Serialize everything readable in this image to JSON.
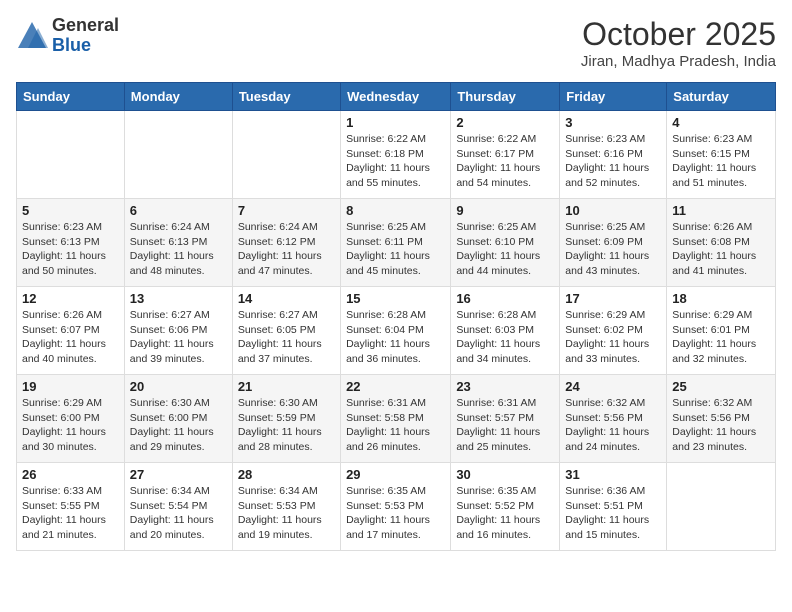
{
  "logo": {
    "general": "General",
    "blue": "Blue"
  },
  "header": {
    "month": "October 2025",
    "location": "Jiran, Madhya Pradesh, India"
  },
  "weekdays": [
    "Sunday",
    "Monday",
    "Tuesday",
    "Wednesday",
    "Thursday",
    "Friday",
    "Saturday"
  ],
  "weeks": [
    [
      {
        "day": "",
        "info": ""
      },
      {
        "day": "",
        "info": ""
      },
      {
        "day": "",
        "info": ""
      },
      {
        "day": "1",
        "info": "Sunrise: 6:22 AM\nSunset: 6:18 PM\nDaylight: 11 hours\nand 55 minutes."
      },
      {
        "day": "2",
        "info": "Sunrise: 6:22 AM\nSunset: 6:17 PM\nDaylight: 11 hours\nand 54 minutes."
      },
      {
        "day": "3",
        "info": "Sunrise: 6:23 AM\nSunset: 6:16 PM\nDaylight: 11 hours\nand 52 minutes."
      },
      {
        "day": "4",
        "info": "Sunrise: 6:23 AM\nSunset: 6:15 PM\nDaylight: 11 hours\nand 51 minutes."
      }
    ],
    [
      {
        "day": "5",
        "info": "Sunrise: 6:23 AM\nSunset: 6:13 PM\nDaylight: 11 hours\nand 50 minutes."
      },
      {
        "day": "6",
        "info": "Sunrise: 6:24 AM\nSunset: 6:13 PM\nDaylight: 11 hours\nand 48 minutes."
      },
      {
        "day": "7",
        "info": "Sunrise: 6:24 AM\nSunset: 6:12 PM\nDaylight: 11 hours\nand 47 minutes."
      },
      {
        "day": "8",
        "info": "Sunrise: 6:25 AM\nSunset: 6:11 PM\nDaylight: 11 hours\nand 45 minutes."
      },
      {
        "day": "9",
        "info": "Sunrise: 6:25 AM\nSunset: 6:10 PM\nDaylight: 11 hours\nand 44 minutes."
      },
      {
        "day": "10",
        "info": "Sunrise: 6:25 AM\nSunset: 6:09 PM\nDaylight: 11 hours\nand 43 minutes."
      },
      {
        "day": "11",
        "info": "Sunrise: 6:26 AM\nSunset: 6:08 PM\nDaylight: 11 hours\nand 41 minutes."
      }
    ],
    [
      {
        "day": "12",
        "info": "Sunrise: 6:26 AM\nSunset: 6:07 PM\nDaylight: 11 hours\nand 40 minutes."
      },
      {
        "day": "13",
        "info": "Sunrise: 6:27 AM\nSunset: 6:06 PM\nDaylight: 11 hours\nand 39 minutes."
      },
      {
        "day": "14",
        "info": "Sunrise: 6:27 AM\nSunset: 6:05 PM\nDaylight: 11 hours\nand 37 minutes."
      },
      {
        "day": "15",
        "info": "Sunrise: 6:28 AM\nSunset: 6:04 PM\nDaylight: 11 hours\nand 36 minutes."
      },
      {
        "day": "16",
        "info": "Sunrise: 6:28 AM\nSunset: 6:03 PM\nDaylight: 11 hours\nand 34 minutes."
      },
      {
        "day": "17",
        "info": "Sunrise: 6:29 AM\nSunset: 6:02 PM\nDaylight: 11 hours\nand 33 minutes."
      },
      {
        "day": "18",
        "info": "Sunrise: 6:29 AM\nSunset: 6:01 PM\nDaylight: 11 hours\nand 32 minutes."
      }
    ],
    [
      {
        "day": "19",
        "info": "Sunrise: 6:29 AM\nSunset: 6:00 PM\nDaylight: 11 hours\nand 30 minutes."
      },
      {
        "day": "20",
        "info": "Sunrise: 6:30 AM\nSunset: 6:00 PM\nDaylight: 11 hours\nand 29 minutes."
      },
      {
        "day": "21",
        "info": "Sunrise: 6:30 AM\nSunset: 5:59 PM\nDaylight: 11 hours\nand 28 minutes."
      },
      {
        "day": "22",
        "info": "Sunrise: 6:31 AM\nSunset: 5:58 PM\nDaylight: 11 hours\nand 26 minutes."
      },
      {
        "day": "23",
        "info": "Sunrise: 6:31 AM\nSunset: 5:57 PM\nDaylight: 11 hours\nand 25 minutes."
      },
      {
        "day": "24",
        "info": "Sunrise: 6:32 AM\nSunset: 5:56 PM\nDaylight: 11 hours\nand 24 minutes."
      },
      {
        "day": "25",
        "info": "Sunrise: 6:32 AM\nSunset: 5:56 PM\nDaylight: 11 hours\nand 23 minutes."
      }
    ],
    [
      {
        "day": "26",
        "info": "Sunrise: 6:33 AM\nSunset: 5:55 PM\nDaylight: 11 hours\nand 21 minutes."
      },
      {
        "day": "27",
        "info": "Sunrise: 6:34 AM\nSunset: 5:54 PM\nDaylight: 11 hours\nand 20 minutes."
      },
      {
        "day": "28",
        "info": "Sunrise: 6:34 AM\nSunset: 5:53 PM\nDaylight: 11 hours\nand 19 minutes."
      },
      {
        "day": "29",
        "info": "Sunrise: 6:35 AM\nSunset: 5:53 PM\nDaylight: 11 hours\nand 17 minutes."
      },
      {
        "day": "30",
        "info": "Sunrise: 6:35 AM\nSunset: 5:52 PM\nDaylight: 11 hours\nand 16 minutes."
      },
      {
        "day": "31",
        "info": "Sunrise: 6:36 AM\nSunset: 5:51 PM\nDaylight: 11 hours\nand 15 minutes."
      },
      {
        "day": "",
        "info": ""
      }
    ]
  ]
}
